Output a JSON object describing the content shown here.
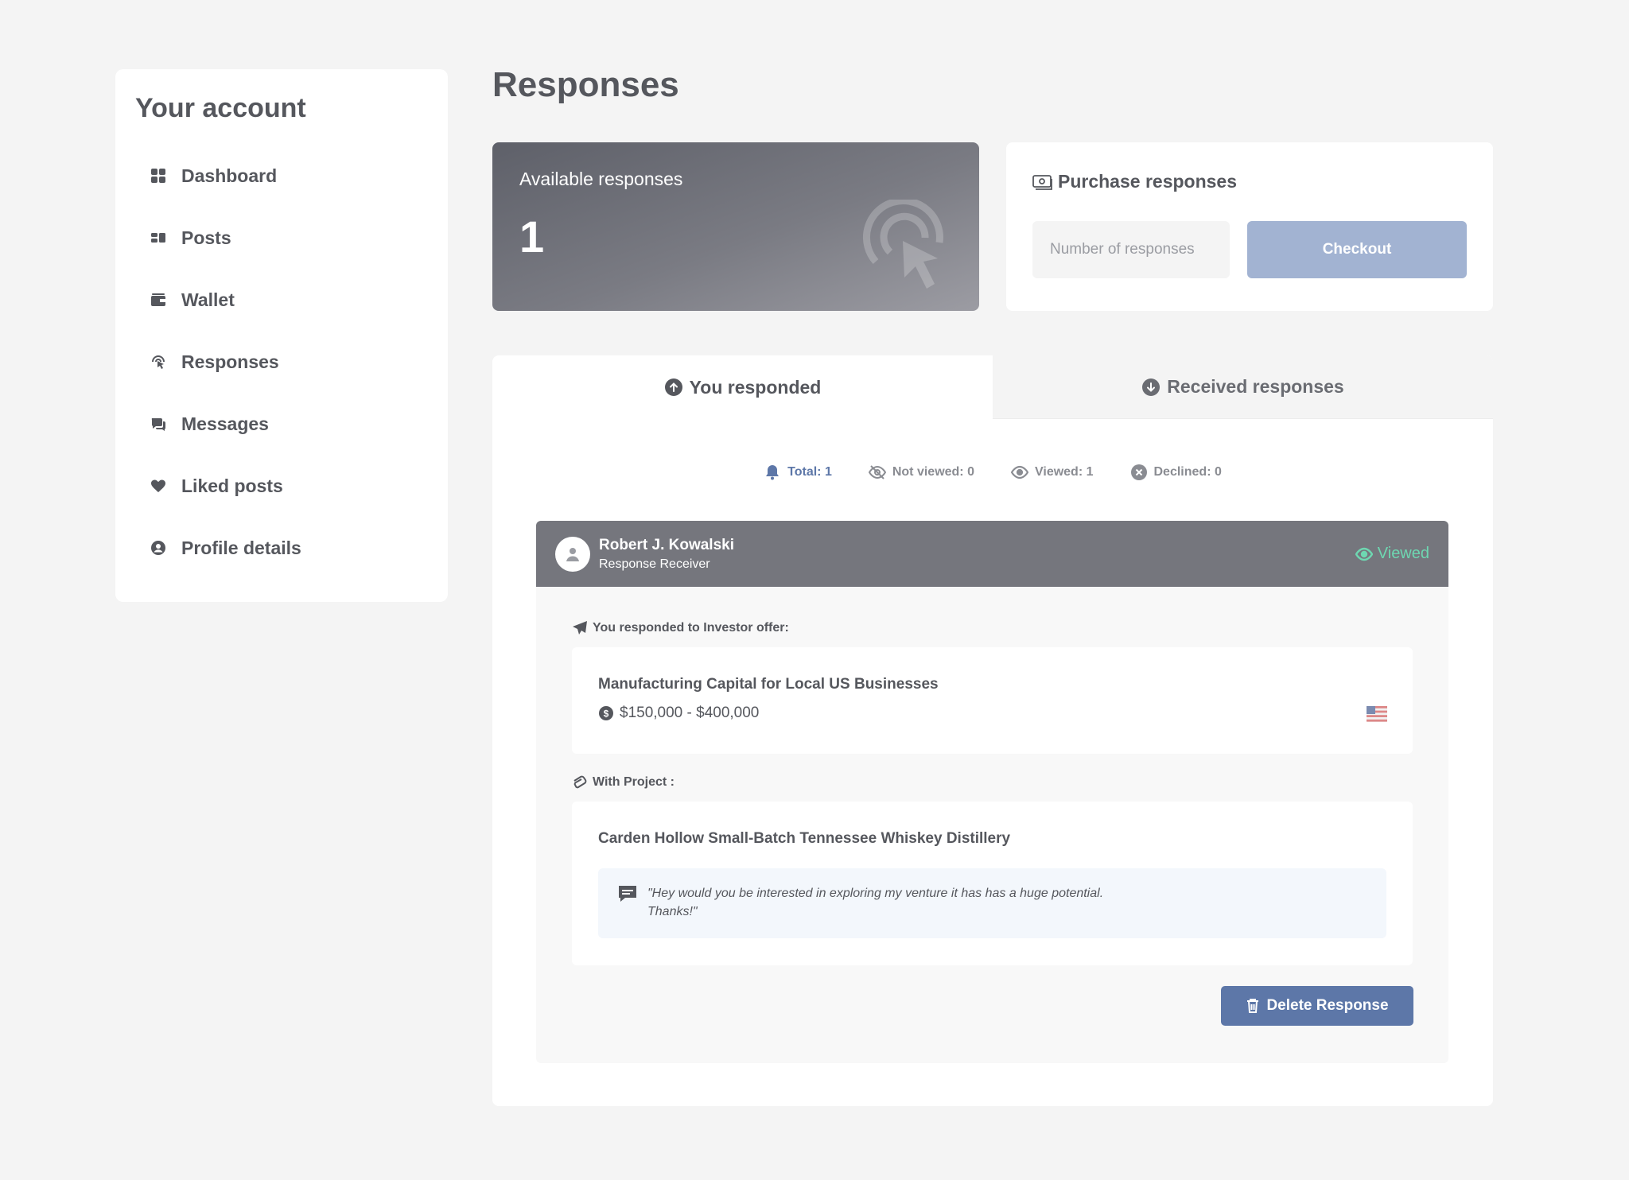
{
  "sidebar": {
    "title": "Your account",
    "items": [
      {
        "label": "Dashboard",
        "icon": "dashboard-icon"
      },
      {
        "label": "Posts",
        "icon": "posts-icon"
      },
      {
        "label": "Wallet",
        "icon": "wallet-icon"
      },
      {
        "label": "Responses",
        "icon": "pointer-click-icon"
      },
      {
        "label": "Messages",
        "icon": "messages-icon"
      },
      {
        "label": "Liked posts",
        "icon": "heart-icon"
      },
      {
        "label": "Profile details",
        "icon": "user-circle-icon"
      }
    ]
  },
  "page": {
    "title": "Responses"
  },
  "available": {
    "label": "Available responses",
    "count": "1"
  },
  "purchase": {
    "title": "Purchase responses",
    "input_placeholder": "Number of responses",
    "input_value": "",
    "checkout_label": "Checkout"
  },
  "tabs": [
    {
      "label": "You responded",
      "active": true
    },
    {
      "label": "Received responses",
      "active": false
    }
  ],
  "stats": {
    "total": "Total: 1",
    "not_viewed": "Not viewed: 0",
    "viewed": "Viewed: 1",
    "declined": "Declined: 0"
  },
  "response": {
    "name": "Robert J. Kowalski",
    "role": "Response Receiver",
    "status": "Viewed",
    "offer_label": "You responded to Investor offer:",
    "offer_title": "Manufacturing Capital for Local US Businesses",
    "offer_amount": "$150,000 - $400,000",
    "project_label": "With Project :",
    "project_title": "Carden Hollow Small-Batch Tennessee Whiskey Distillery",
    "message_line1": "\"Hey would you be interested in exploring my venture it has has a huge potential.",
    "message_line2": "Thanks!\"",
    "delete_label": "Delete Response"
  },
  "colors": {
    "background": "#f4f4f4",
    "accent": "#5d77a8",
    "checkout_disabled": "#a2b3d2",
    "viewed_green": "#6ed7b1",
    "card_header": "#75767d"
  }
}
